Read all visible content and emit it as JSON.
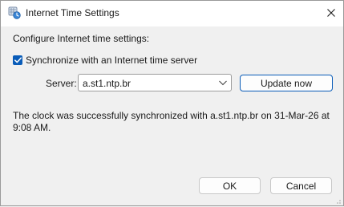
{
  "window": {
    "title": "Internet Time Settings",
    "app_icon": "clock-globe-icon",
    "close_icon": "close-icon"
  },
  "main": {
    "heading": "Configure Internet time settings:",
    "sync_checkbox": {
      "label": "Synchronize with an Internet time server",
      "checked": true
    },
    "server": {
      "label": "Server:",
      "value": "a.st1.ntp.br"
    },
    "update_button_label": "Update now",
    "status_message": "The clock was successfully synchronized with a.st1.ntp.br on 31-Mar-26 at 9:08 AM."
  },
  "footer": {
    "ok_label": "OK",
    "cancel_label": "Cancel"
  },
  "colors": {
    "accent": "#0a5cb8",
    "titlebar": "#ffffff",
    "dialog_background": "#f0f0f0"
  }
}
